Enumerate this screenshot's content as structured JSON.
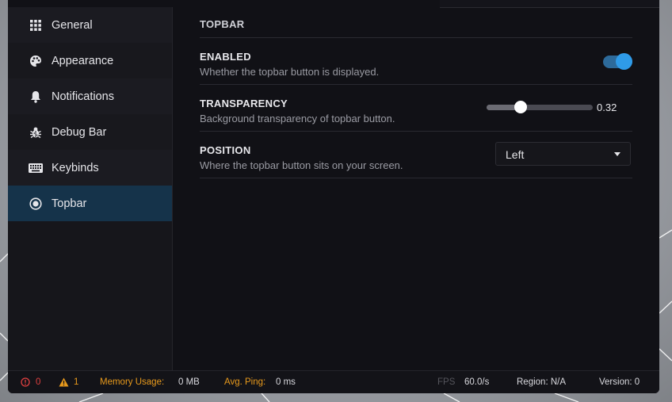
{
  "sidebar": {
    "items": [
      {
        "label": "General",
        "icon": "grid-icon"
      },
      {
        "label": "Appearance",
        "icon": "palette-icon"
      },
      {
        "label": "Notifications",
        "icon": "bell-icon"
      },
      {
        "label": "Debug Bar",
        "icon": "bug-icon"
      },
      {
        "label": "Keybinds",
        "icon": "keyboard-icon"
      },
      {
        "label": "Topbar",
        "icon": "radio-icon",
        "active": true
      }
    ]
  },
  "main": {
    "section_title": "TOPBAR",
    "settings": {
      "enabled": {
        "label": "ENABLED",
        "desc": "Whether the topbar button is displayed.",
        "value": true
      },
      "transparency": {
        "label": "TRANSPARENCY",
        "desc": "Background transparency of topbar button.",
        "value": "0.32"
      },
      "position": {
        "label": "POSITION",
        "desc": "Where the topbar button sits on your screen.",
        "value": "Left"
      }
    }
  },
  "footer": {
    "errors": "0",
    "warnings": "1",
    "memory_label": "Memory Usage:",
    "memory_value": "0 MB",
    "ping_label": "Avg. Ping:",
    "ping_value": "0 ms",
    "fps_label": "FPS",
    "fps_value": "60.0/s",
    "region": "Region: N/A",
    "version": "Version: 0"
  },
  "colors": {
    "accent": "#2f9be8",
    "active_bg": "#15334a",
    "warning": "#e89a1c",
    "error": "#e04040"
  }
}
